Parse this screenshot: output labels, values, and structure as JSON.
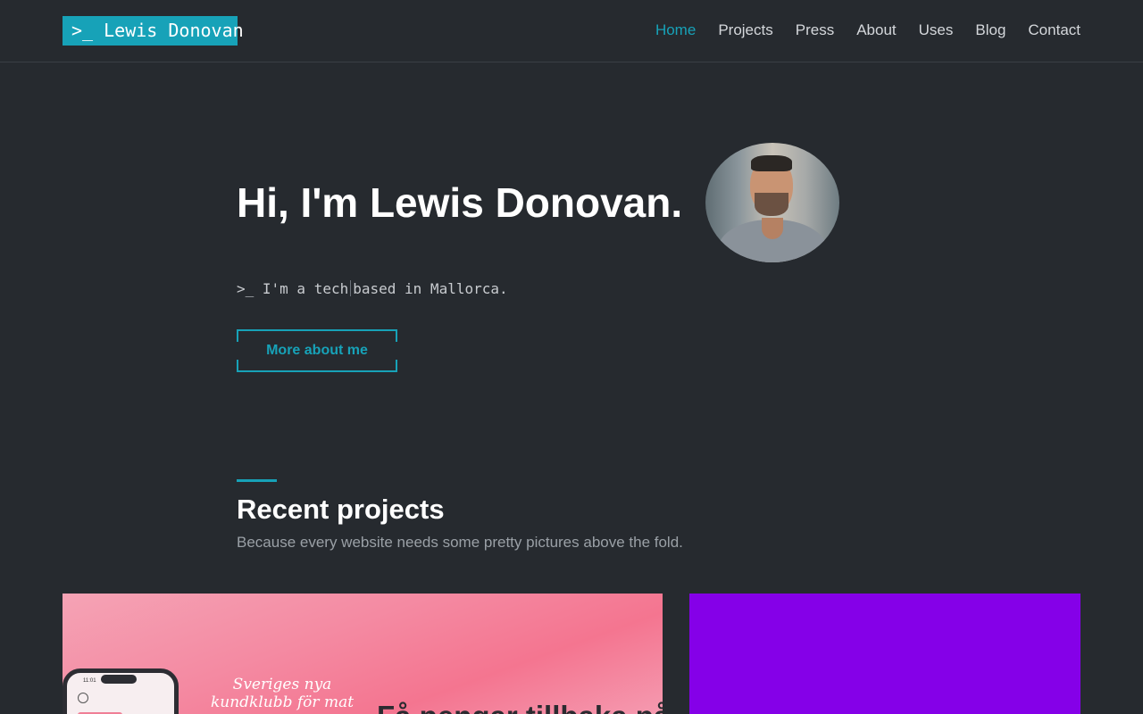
{
  "header": {
    "logo_text": ">_ Lewis Donovan",
    "nav": {
      "home": "Home",
      "projects": "Projects",
      "press": "Press",
      "about": "About",
      "uses": "Uses",
      "blog": "Blog",
      "contact": "Contact"
    },
    "active_nav": "Home"
  },
  "hero": {
    "title": "Hi, I'm Lewis Donovan.",
    "tagline_before_cursor": ">_ I'm a tech",
    "tagline_after_cursor": "based in Mallorca.",
    "button_label": "More about me"
  },
  "projects_section": {
    "title": "Recent projects",
    "subtitle": "Because every website needs some pretty pictures above the fold.",
    "cards": [
      {
        "handwritten_text": "Sveriges nya kundklubb för mat",
        "headline": "Få pengar tillbaka på",
        "phone_time": "11:01",
        "background": "#f48aa2"
      },
      {
        "background": "#8500e8"
      }
    ]
  },
  "colors": {
    "accent": "#17a2b8",
    "background": "#262a2f",
    "text_primary": "#ffffff",
    "text_muted": "#9aa0a6"
  }
}
